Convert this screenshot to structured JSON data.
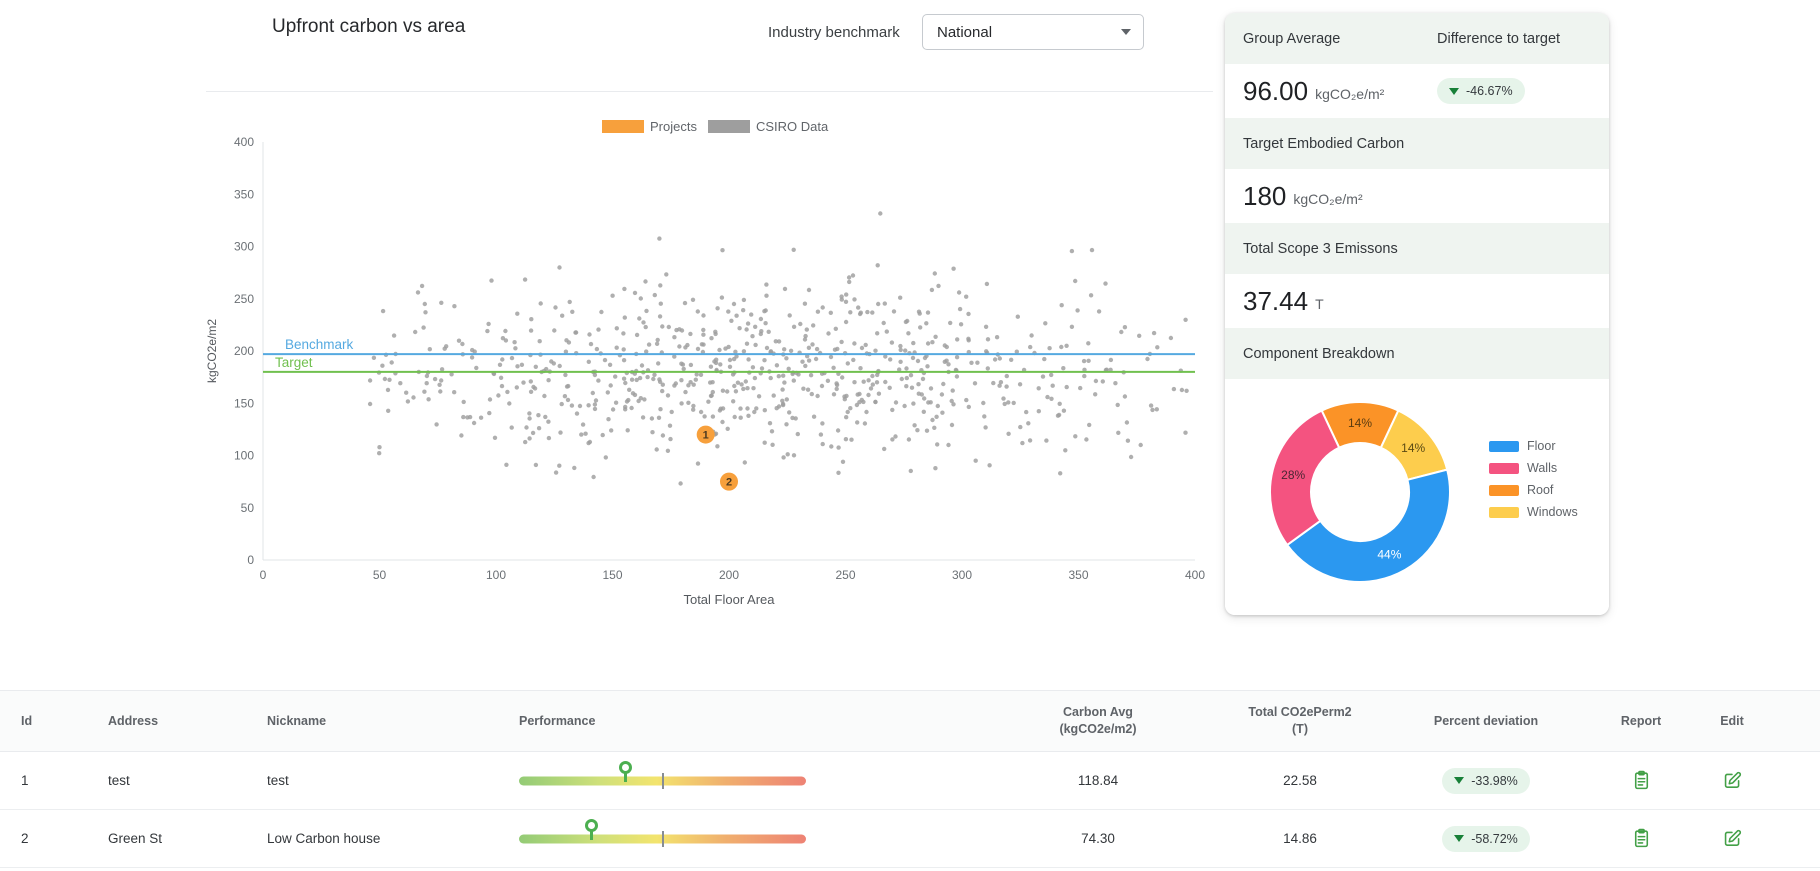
{
  "controls": {
    "benchmark_label": "Industry benchmark",
    "benchmark_value": "National"
  },
  "chart_data": [
    {
      "type": "scatter",
      "title": "Upfront carbon vs area",
      "xlabel": "Total Floor Area",
      "ylabel": "kgCO2e/m2",
      "xlim": [
        0,
        400
      ],
      "ylim": [
        0,
        400
      ],
      "x_ticks": [
        0,
        50,
        100,
        150,
        200,
        250,
        300,
        350,
        400
      ],
      "y_ticks": [
        0,
        50,
        100,
        150,
        200,
        250,
        300,
        350,
        400
      ],
      "grid": false,
      "legend_position": "top",
      "reference_lines": [
        {
          "label": "Benchmark",
          "value": 197,
          "color": "#55a9e0"
        },
        {
          "label": "Target",
          "value": 180,
          "color": "#71c04f"
        }
      ],
      "series": [
        {
          "name": "Projects",
          "color": "#f7a03c",
          "label_color": "#4c3a20",
          "points": [
            {
              "label": "1",
              "x": 190,
              "y": 120
            },
            {
              "label": "2",
              "x": 200,
              "y": 75
            }
          ]
        },
        {
          "name": "CSIRO Data",
          "color": "#9e9e9e",
          "point_cloud": {
            "note": "dense unlabeled background cloud; distribution estimated from pixels",
            "count": 760,
            "seed": 7,
            "x_mean": 215,
            "x_std": 78,
            "x_uniform_share": 0.22,
            "x_min": 45,
            "x_max": 398,
            "y_mean": 183,
            "y_std": 44,
            "y_min": 55,
            "y_max": 345
          }
        }
      ]
    },
    {
      "type": "pie",
      "donut": true,
      "title": "Component Breakdown",
      "labels_show_percent": true,
      "legend_position": "right",
      "slices": [
        {
          "label": "Floor",
          "value": 44,
          "color": "#2b98f0",
          "label_color": "#ffffff"
        },
        {
          "label": "Walls",
          "value": 28,
          "color": "#f45380",
          "label_color": "#4a2633"
        },
        {
          "label": "Roof",
          "value": 14,
          "color": "#fb9327",
          "label_color": "#5b3c10"
        },
        {
          "label": "Windows",
          "value": 14,
          "color": "#fdcd4d",
          "label_color": "#5b4a14"
        }
      ],
      "draw_order": [
        2,
        3,
        0,
        1
      ]
    }
  ],
  "summary_card": {
    "group_average_label": "Group Average",
    "difference_label": "Difference to target",
    "group_average_value": "96.00",
    "group_average_unit": "kgCO₂e/m²",
    "difference_badge": "-46.67%",
    "target_label": "Target Embodied Carbon",
    "target_value": "180",
    "target_unit": "kgCO₂e/m²",
    "scope3_label": "Total Scope 3 Emissons",
    "scope3_value": "37.44",
    "scope3_unit": "T",
    "breakdown_label": "Component Breakdown"
  },
  "table": {
    "headers": {
      "id": "Id",
      "address": "Address",
      "nickname": "Nickname",
      "performance": "Performance",
      "carbon_l1": "Carbon Avg",
      "carbon_l2": "(kgCO2e/m2)",
      "total_l1": "Total CO2ePerm2",
      "total_l2": "(T)",
      "deviation": "Percent deviation",
      "report": "Report",
      "edit": "Edit"
    },
    "rows": [
      {
        "id": "1",
        "address": "test",
        "nickname": "test",
        "performance_position": 0.37,
        "carbon_avg": "118.84",
        "total_co2e": "22.58",
        "percent_deviation": "-33.98%"
      },
      {
        "id": "2",
        "address": "Green St",
        "nickname": "Low Carbon house",
        "performance_position": 0.25,
        "carbon_avg": "74.30",
        "total_co2e": "14.86",
        "percent_deviation": "-58.72%"
      }
    ]
  },
  "colors": {
    "badge_bg": "#e6f4ea",
    "badge_arrow": "#188038",
    "icon_green": "#43a047",
    "pin_green": "#4caf50",
    "strip_bg": "#eff4f0"
  }
}
